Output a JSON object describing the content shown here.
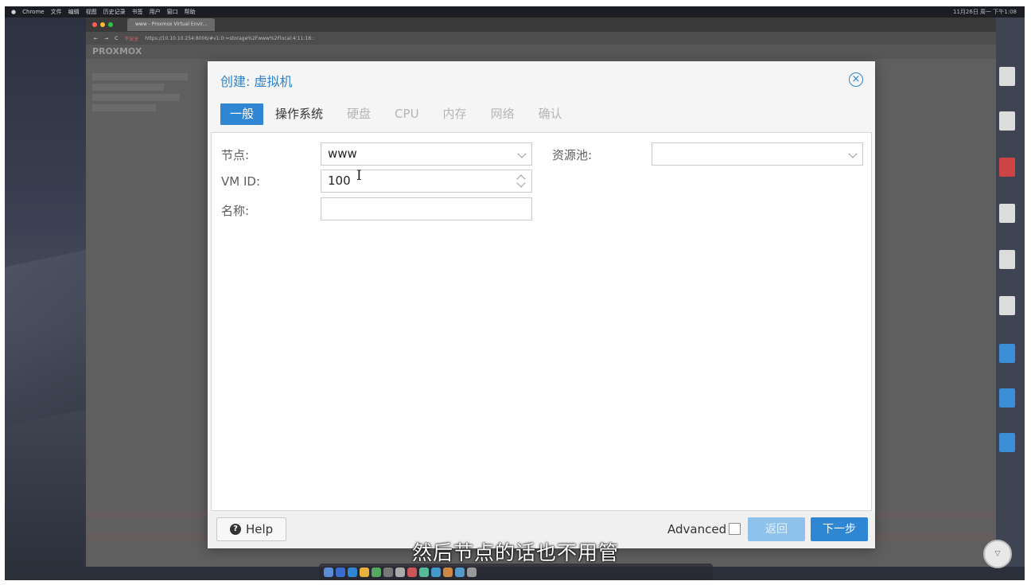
{
  "desktop": {
    "menubar": {
      "app": "Chrome",
      "items": [
        "文件",
        "编辑",
        "视图",
        "历史记录",
        "书签",
        "用户",
        "窗口",
        "帮助"
      ],
      "clock": "11月26日 周一 下午1:08"
    },
    "browser": {
      "tab_title": "www - Proxmox Virtual Envir...",
      "security_label": "不安全",
      "url": "https://10.10.10.254:8006/#v1:0:=storage%2Fwww%2Flocal:4:11:18::",
      "app_name": "PROXMOX"
    }
  },
  "dialog": {
    "title": "创建: 虚拟机",
    "tabs": [
      {
        "label": "一般"
      },
      {
        "label": "操作系统"
      },
      {
        "label": "硬盘"
      },
      {
        "label": "CPU"
      },
      {
        "label": "内存"
      },
      {
        "label": "网络"
      },
      {
        "label": "确认"
      }
    ],
    "form": {
      "node_label": "节点:",
      "node_value": "www",
      "pool_label": "资源池:",
      "pool_value": "",
      "vmid_label": "VM ID:",
      "vmid_value": "100",
      "name_label": "名称:",
      "name_value": ""
    },
    "footer": {
      "help_label": "Help",
      "advanced_label": "Advanced",
      "advanced_checked": false,
      "back_label": "返回",
      "next_label": "下一步"
    }
  },
  "subtitle": "然后节点的话也不用管",
  "colors": {
    "accent": "#2f86d3",
    "accent_disabled": "#8fc2ea",
    "title": "#2d83cc"
  }
}
